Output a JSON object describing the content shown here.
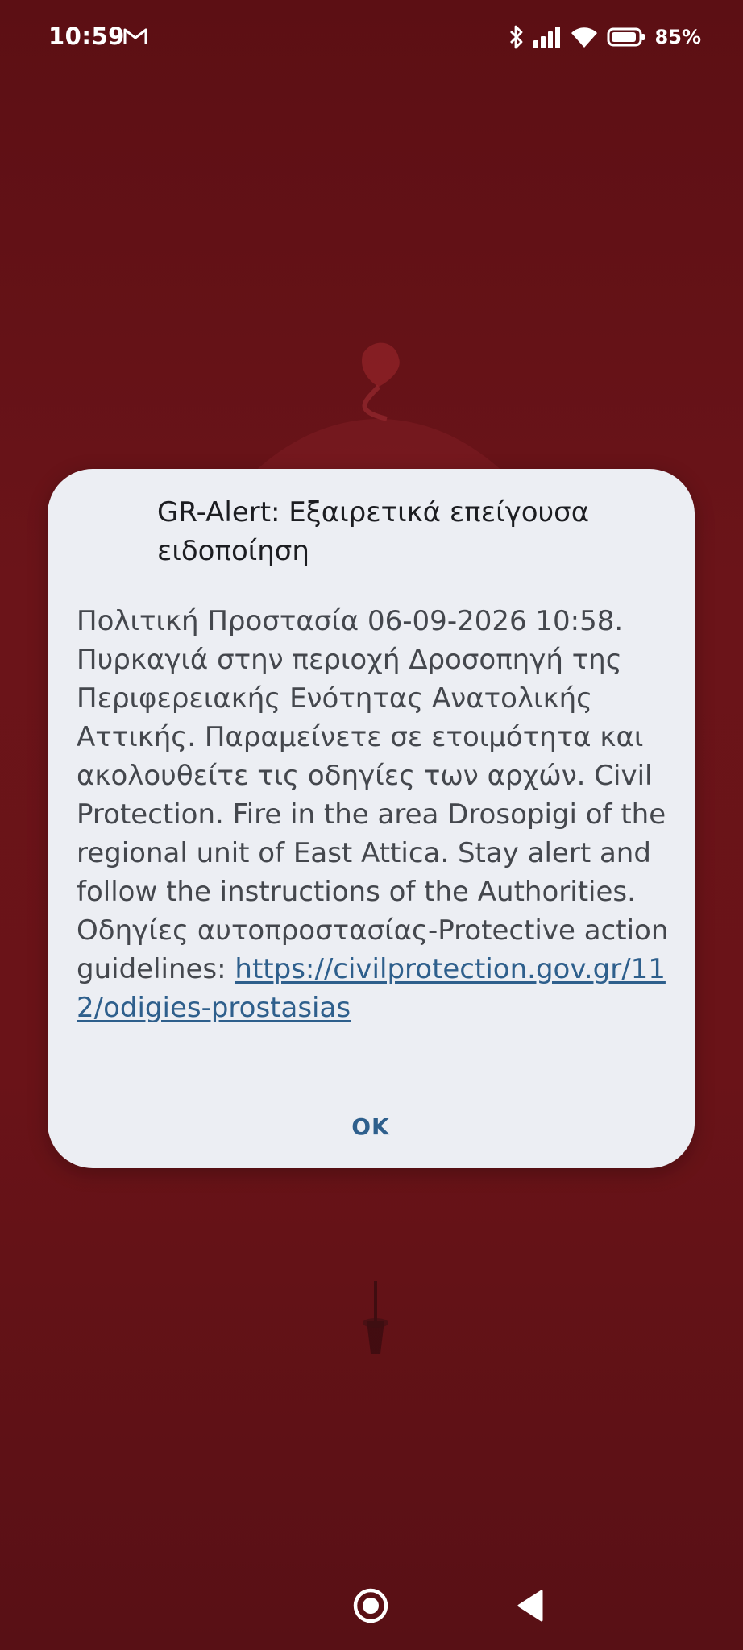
{
  "status_bar": {
    "time": "10:59",
    "notification_icon": "gmail-icon",
    "bluetooth_icon": "bluetooth-icon",
    "signal_icon": "signal-icon",
    "wifi_icon": "wifi-icon",
    "battery_icon": "battery-icon",
    "battery_level": "85%"
  },
  "dialog": {
    "title": "GR-Alert: Εξαιρετικά επείγουσα ειδοποίηση",
    "body_text": "Πολιτική Προστασία 06-09-2026 10:58. Πυρκαγιά στην περιοχή Δροσοπηγή της Περιφερειακής Ενότητας Ανατολικής Αττικής. Παραμείνετε σε ετοιμότητα και ακολουθείτε τις οδηγίες των αρχών. Civil Protection. Fire in the area Drosopigi of the regional unit of East Attica. Stay alert and follow the instructions of the Authorities. Οδηγίες αυτοπροστασίας-Protective action guidelines: ",
    "link_text": "https://civilprotection.gov.gr/112/odigies-prostasias",
    "ok_label": "OK"
  },
  "nav_bar": {
    "home_icon": "home-icon",
    "back_icon": "back-icon"
  },
  "colors": {
    "background": "#6a1318",
    "dialog": "#eceef3",
    "accent": "#2e5f8c",
    "title_text": "#1c1d21",
    "body_text": "#44474d"
  }
}
